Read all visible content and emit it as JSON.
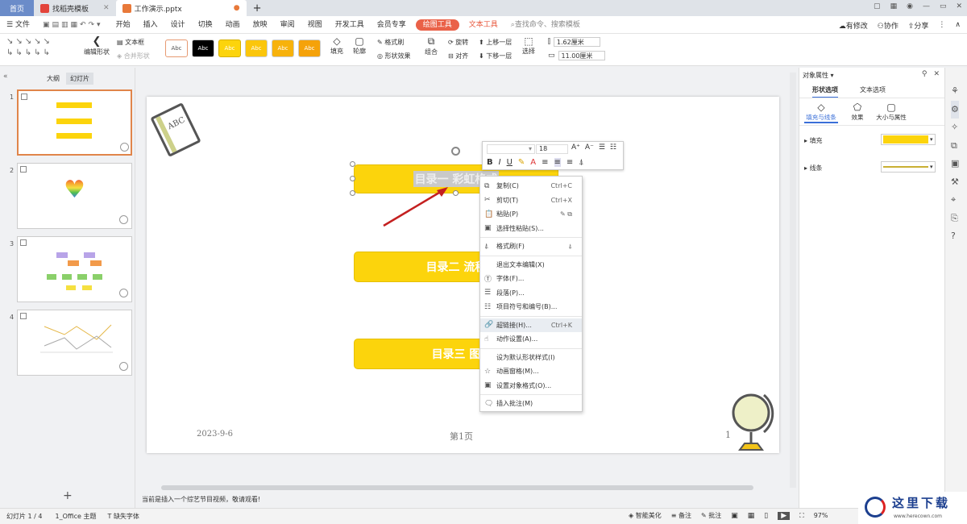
{
  "titlebar": {
    "home_tab": "首页",
    "tab1": "找稻壳模板",
    "tab2": "工作演示.pptx",
    "new_tab": "+"
  },
  "menubar": {
    "file": "文件",
    "items": [
      "开始",
      "插入",
      "设计",
      "切换",
      "动画",
      "放映",
      "审阅",
      "视图",
      "开发工具",
      "会员专享"
    ],
    "drawing_tools": "绘图工具",
    "text_tools": "文本工具",
    "search_placeholder": "查找命令、搜索模板",
    "changes": "有修改",
    "collab": "协作",
    "share": "分享"
  },
  "ribbon": {
    "edit_shape": "编辑形状",
    "text_box": "文本框",
    "merge_shape": "合并形状",
    "style_labels": [
      "Abc",
      "Abc",
      "Abc",
      "Abc",
      "Abc",
      "Abc"
    ],
    "fill": "填充",
    "outline": "轮廓",
    "format_painter": "格式刷",
    "shape_effects": "形状效果",
    "combine": "组合",
    "rotate": "旋转",
    "align": "对齐",
    "bring_forward": "上移一层",
    "send_backward": "下移一层",
    "select": "选择",
    "width": "1.62厘米",
    "height": "11.00厘米"
  },
  "leftpanel": {
    "tab_outline": "大纲",
    "tab_slides": "幻灯片",
    "slide_numbers": [
      "1",
      "2",
      "3",
      "4"
    ],
    "add": "+"
  },
  "slide": {
    "box1": "目录一  彩虹格式",
    "box2": "目录二    流程",
    "box3": "目录三     图",
    "date": "2023-9-6",
    "page": "第1页",
    "pagenum": "1",
    "abc": "ABC"
  },
  "minibar": {
    "size": "18"
  },
  "context_menu": {
    "copy": "复制(C)",
    "copy_sc": "Ctrl+C",
    "cut": "剪切(T)",
    "cut_sc": "Ctrl+X",
    "paste": "粘贴(P)",
    "paste_special": "选择性粘贴(S)...",
    "format_brush": "格式刷(F)",
    "exit_edit": "退出文本编辑(X)",
    "font": "字体(F)...",
    "paragraph": "段落(P)...",
    "bullets": "项目符号和编号(B)...",
    "hyperlink": "超链接(H)...",
    "hyperlink_sc": "Ctrl+K",
    "action": "动作设置(A)...",
    "default_shape": "设为默认形状样式(I)",
    "animation": "动画窗格(M)...",
    "object_format": "设置对象格式(O)...",
    "insert_comment": "插入批注(M)"
  },
  "rightpanel": {
    "title": "对象属性",
    "tab_shape": "形状选项",
    "tab_text": "文本选项",
    "sub_fill_line": "填充与线条",
    "sub_effect": "效果",
    "sub_size": "大小与属性",
    "fill_label": "填充",
    "line_label": "线条",
    "fill_color": "#fcd40c"
  },
  "notice": "当前是插入一个综艺节目视频，敬请观看!",
  "statusbar": {
    "slide_count": "幻灯片 1 / 4",
    "theme": "1_Office 主题",
    "missing_font": "缺失字体",
    "smart": "智能美化",
    "notes": "备注",
    "comments": "批注",
    "zoom": "97%"
  },
  "watermark": {
    "site_cn": "这里下载",
    "site_url": "www.herecown.com"
  }
}
